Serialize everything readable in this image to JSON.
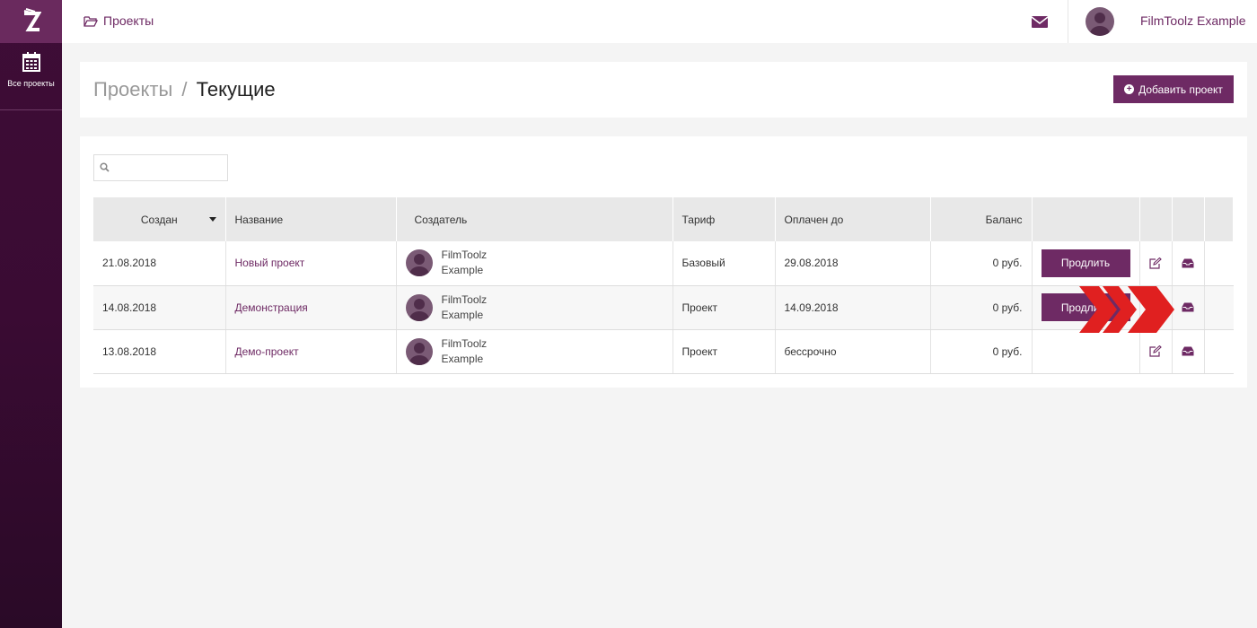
{
  "sidebar": {
    "items": [
      {
        "label": "Все проекты",
        "icon": "calendar-icon"
      }
    ]
  },
  "topbar": {
    "breadcrumb": "Проекты",
    "user_name": "FilmToolz Example"
  },
  "header": {
    "title_parent": "Проекты",
    "title_sep": "/",
    "title_current": "Текущие",
    "add_button": "Добавить проект"
  },
  "search": {
    "placeholder": ""
  },
  "table": {
    "columns": [
      "Создан",
      "Название",
      "Создатель",
      "Тариф",
      "Оплачен до",
      "Баланс"
    ],
    "rows": [
      {
        "created": "21.08.2018",
        "name": "Новый проект",
        "creator_first": "FilmToolz",
        "creator_last": "Example",
        "tariff": "Базовый",
        "paid_until": "29.08.2018",
        "balance": "0 руб.",
        "action": "Продлить"
      },
      {
        "created": "14.08.2018",
        "name": "Демонстрация",
        "creator_first": "FilmToolz",
        "creator_last": "Example",
        "tariff": "Проект",
        "paid_until": "14.09.2018",
        "balance": "0 руб.",
        "action": "Продлить"
      },
      {
        "created": "13.08.2018",
        "name": "Демо-проект",
        "creator_first": "FilmToolz",
        "creator_last": "Example",
        "tariff": "Проект",
        "paid_until": "бессрочно",
        "balance": "0 руб.",
        "action": ""
      }
    ]
  },
  "colors": {
    "accent": "#6e2a64",
    "sidebar": "#3e0d36",
    "arrow": "#e02020"
  }
}
